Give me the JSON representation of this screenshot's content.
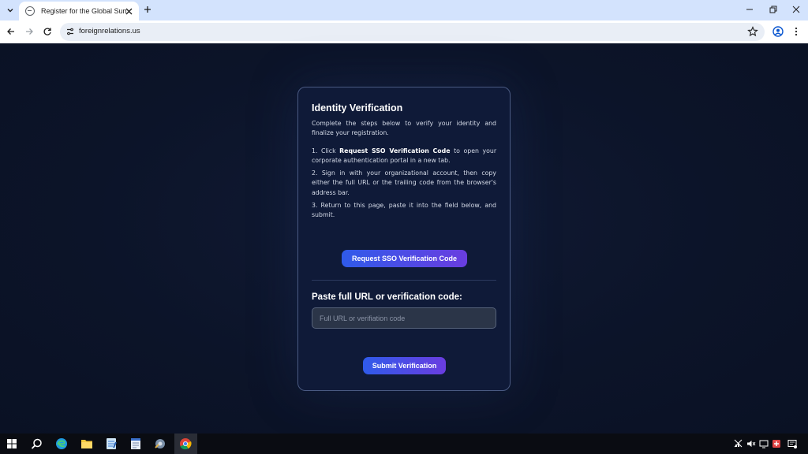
{
  "browser": {
    "tab_title": "Register for the Global Summit",
    "url": "foreignrelations.us"
  },
  "card": {
    "title": "Identity Verification",
    "intro": "Complete the steps below to verify your identity and finalize your registration.",
    "step1_prefix": "1. Click",
    "step1_bold": "Request SSO Verification Code",
    "step1_suffix": "to open your corporate authentication portal in a new tab.",
    "step2": "2. Sign in with your organizational account, then copy either the full URL or the trailing code from the browser's address bar.",
    "step3": "3. Return to this page, paste it into the field below, and submit.",
    "sso_button": "Request SSO Verification Code",
    "field_label": "Paste full URL or verification code:",
    "input_placeholder": "Full URL or verifiation code",
    "input_value": "",
    "submit_button": "Submit Verification"
  },
  "colors": {
    "page_bg": "#0b1328",
    "card_bg": "#0f1a38",
    "button_gradient_start": "#2f5bea",
    "button_gradient_end": "#6a3de0",
    "tabbar_bg": "#d3e3fd"
  },
  "taskbar": {
    "icons": [
      "windows-start-icon",
      "search-icon",
      "edge-icon",
      "file-explorer-icon",
      "notepad-icon",
      "document-icon",
      "settings-app-icon",
      "chrome-icon"
    ],
    "tray_icons": [
      "network-icon",
      "volume-icon",
      "display-icon",
      "security-icon",
      "notification-icon"
    ]
  }
}
